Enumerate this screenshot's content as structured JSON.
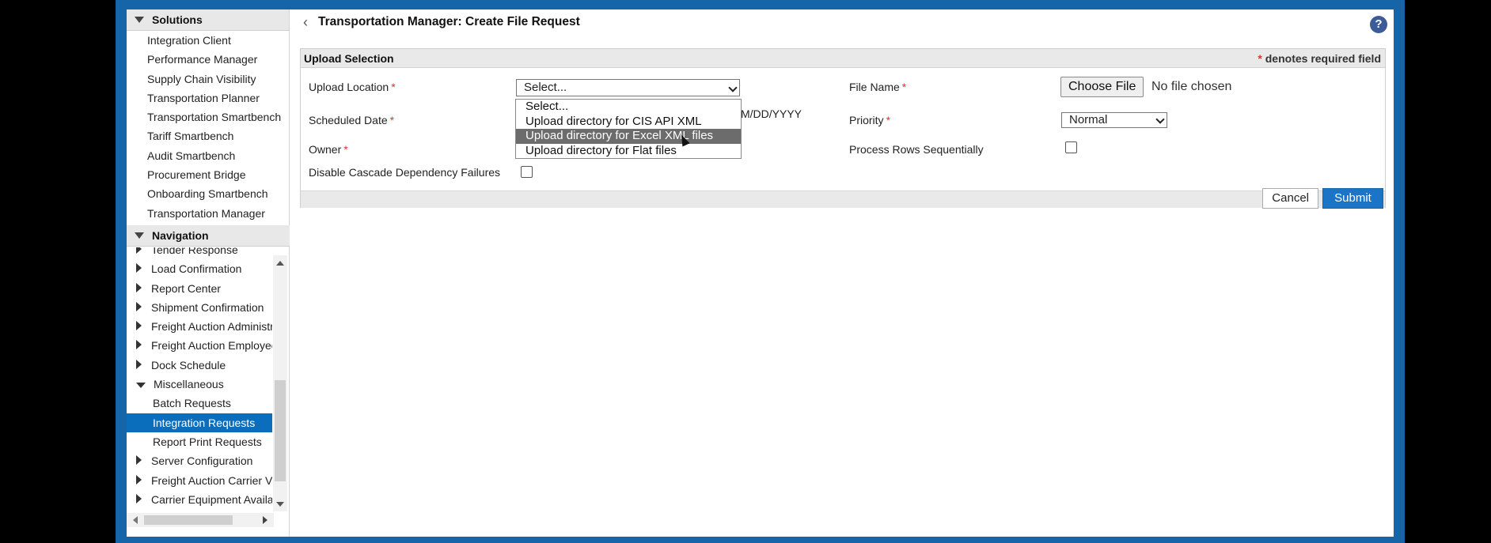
{
  "sidebar": {
    "solutions_title": "Solutions",
    "solutions": [
      "Integration Client",
      "Performance Manager",
      "Supply Chain Visibility",
      "Transportation Planner",
      "Transportation Smartbench",
      "Tariff Smartbench",
      "Audit Smartbench",
      "Procurement Bridge",
      "Onboarding Smartbench",
      "Transportation Manager"
    ],
    "navigation_title": "Navigation",
    "navigation": [
      "Tender Response",
      "Load Confirmation",
      "Report Center",
      "Shipment Confirmation",
      "Freight Auction Administr",
      "Freight Auction Employee",
      "Dock Schedule",
      "Miscellaneous",
      "Batch Requests",
      "Integration Requests",
      "Report Print Requests",
      "Server Configuration",
      "Freight Auction Carrier V",
      "Carrier Equipment Availa"
    ]
  },
  "page": {
    "title": "Transportation Manager: Create File Request",
    "help": "?"
  },
  "panel": {
    "title": "Upload Selection",
    "required_note": "denotes required field",
    "star": "*"
  },
  "form": {
    "upload_location_label": "Upload Location",
    "upload_location_value": "Select...",
    "scheduled_date_label": "Scheduled Date",
    "date_format_hint": "M/DD/YYYY",
    "owner_label": "Owner",
    "disable_cascade_label": "Disable Cascade Dependency Failures",
    "file_name_label": "File Name",
    "choose_file": "Choose File",
    "no_file": "No file chosen",
    "priority_label": "Priority",
    "priority_value": "Normal",
    "process_rows_label": "Process Rows Sequentially"
  },
  "dropdown": {
    "options": [
      "Select...",
      "Upload directory for CIS API XML",
      "Upload directory for Excel XML files",
      "Upload directory for Flat files"
    ]
  },
  "buttons": {
    "cancel": "Cancel",
    "submit": "Submit"
  }
}
